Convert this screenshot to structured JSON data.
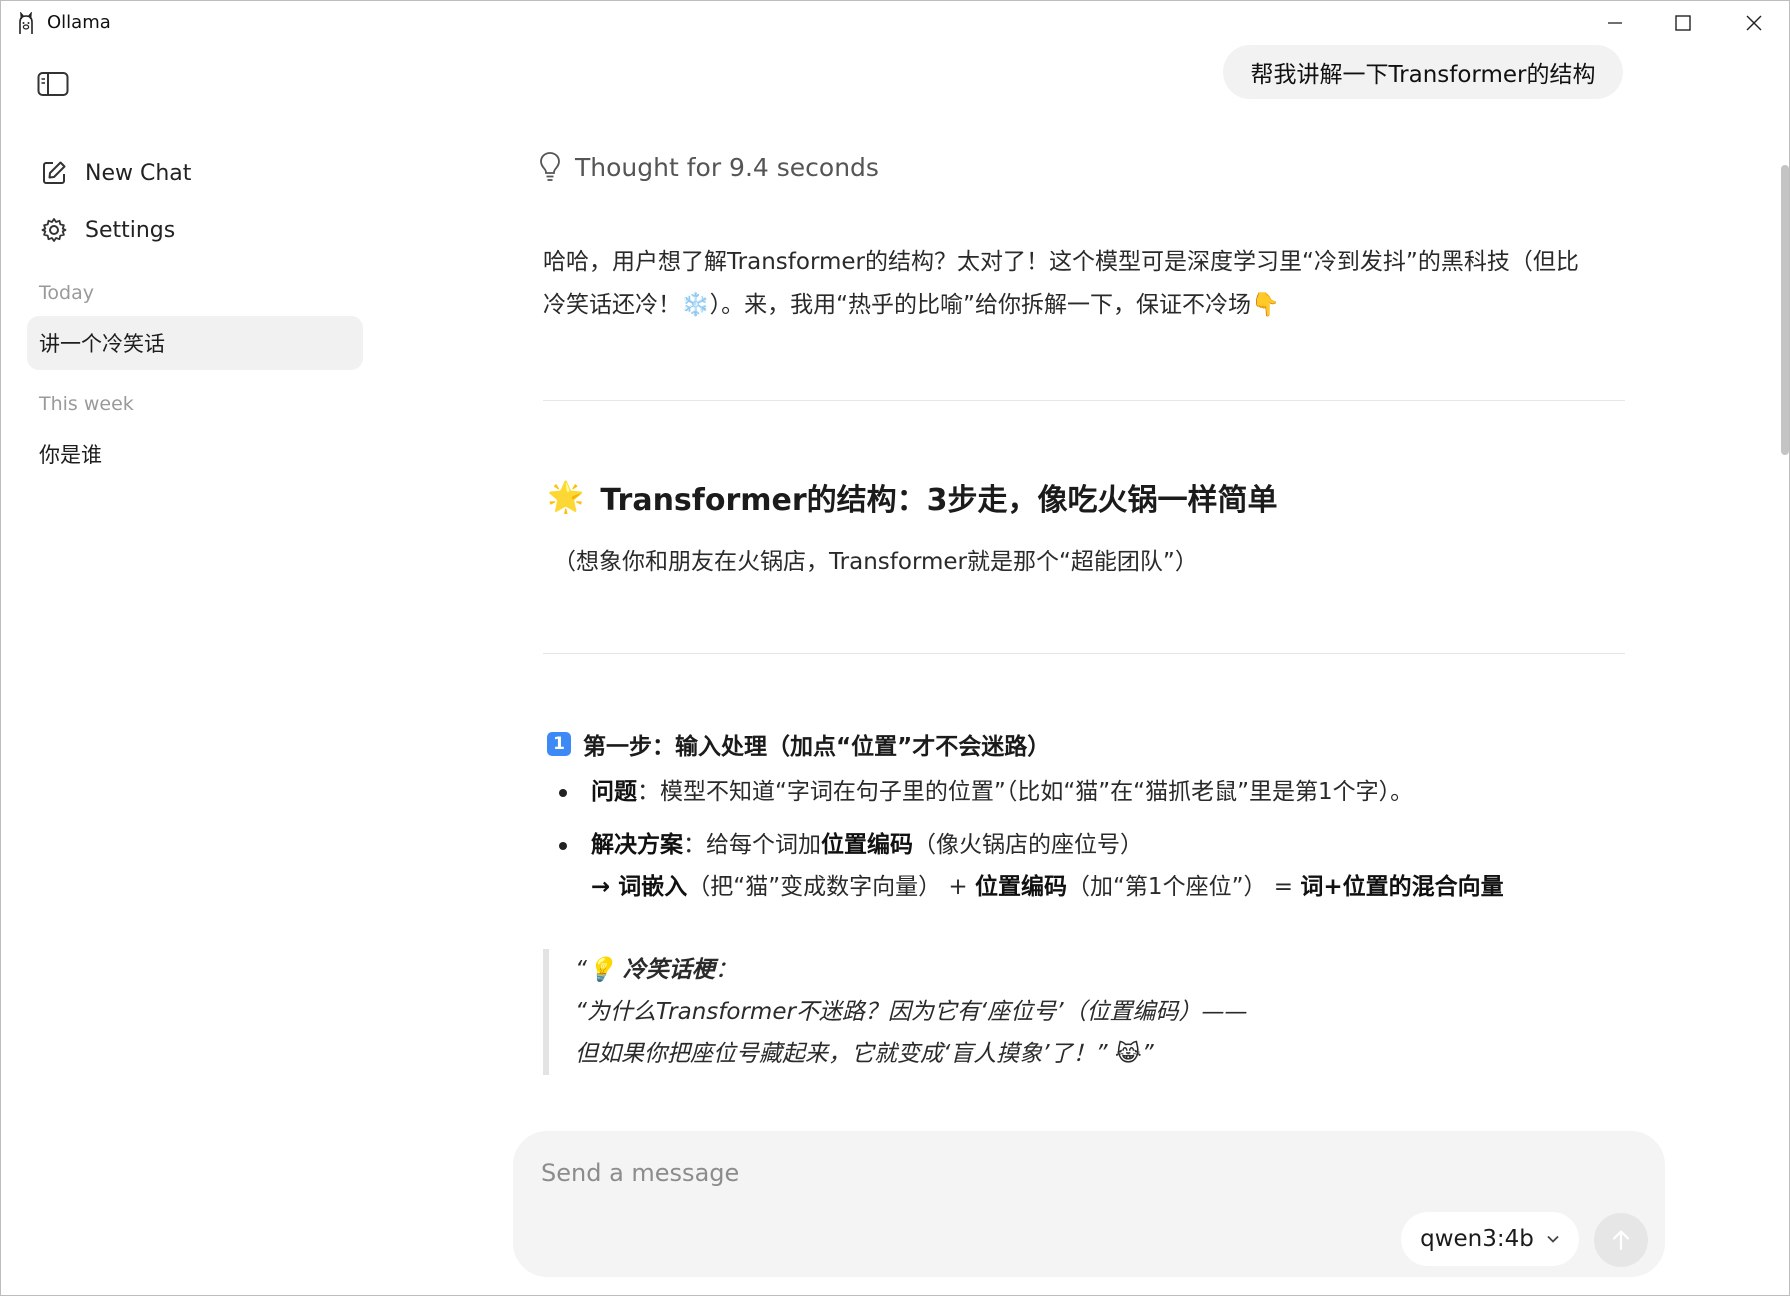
{
  "window": {
    "title": "Ollama"
  },
  "sidebar": {
    "new_chat_label": "New Chat",
    "settings_label": "Settings",
    "groups": [
      {
        "label": "Today",
        "items": [
          {
            "title": "讲一个冷笑话",
            "active": true
          }
        ]
      },
      {
        "label": "This week",
        "items": [
          {
            "title": "你是谁",
            "active": false
          }
        ]
      }
    ]
  },
  "conversation": {
    "user_message": "帮我讲解一下Transformer的结构",
    "thought_label": "Thought for 9.4 seconds",
    "intro_line1": "哈哈，用户想了解Transformer的结构？太对了！这个模型可是深度学习里“冷到发抖”的黑科技（但比",
    "intro_line2": "冷笑话还冷！❄️）。来，我用“热乎的比喻”给你拆解一下，保证不冷场👇",
    "heading_emoji": "🌟",
    "heading": "Transformer的结构：3步走，像吃火锅一样简单",
    "subheading": "（想象你和朋友在火锅店，Transformer就是那个“超能团队”）",
    "step1_keycap": "1",
    "step1_title": "第一步：输入处理（加点“位置”才不会迷路）",
    "bullet1_bold": "问题",
    "bullet1_text": "：模型不知道“字词在句子里的位置”（比如“猫”在“猫抓老鼠”里是第1个字）。",
    "bullet2_bold": "解决方案",
    "bullet2_text": "：给每个词加",
    "bullet2_bold2": "位置编码",
    "bullet2_text2": "（像火锅店的座位号）",
    "bullet2_arrow": "→ ",
    "bullet2_bold3": "词嵌入",
    "bullet2_text3": "（把“猫”变成数字向量）  + ",
    "bullet2_bold4": "位置编码",
    "bullet2_text4": "（加“第1个座位”）  = ",
    "bullet2_bold5": "词+位置的混合向量",
    "quote_prefix": "“💡 ",
    "quote_bold": "冷笑话梗",
    "quote_colon": "：",
    "quote_line2": "“为什么Transformer不迷路？因为它有‘座位号’（位置编码）——",
    "quote_line3": "但如果你把座位号藏起来，它就变成‘盲人摸象’了！” 😹”"
  },
  "composer": {
    "placeholder": "Send a message",
    "model": "qwen3:4b"
  },
  "colors": {
    "accent_keycap": "#3d8af7",
    "active_item_bg": "#f1f1f1",
    "bubble_bg": "#f2f2f2"
  },
  "icons": {
    "app": "llama-icon",
    "sidebar_toggle": "sidebar-toggle-icon",
    "new_chat": "edit-square-icon",
    "settings": "gear-icon",
    "thought": "lightbulb-icon",
    "dropdown": "chevron-down-icon",
    "send": "arrow-up-icon"
  }
}
